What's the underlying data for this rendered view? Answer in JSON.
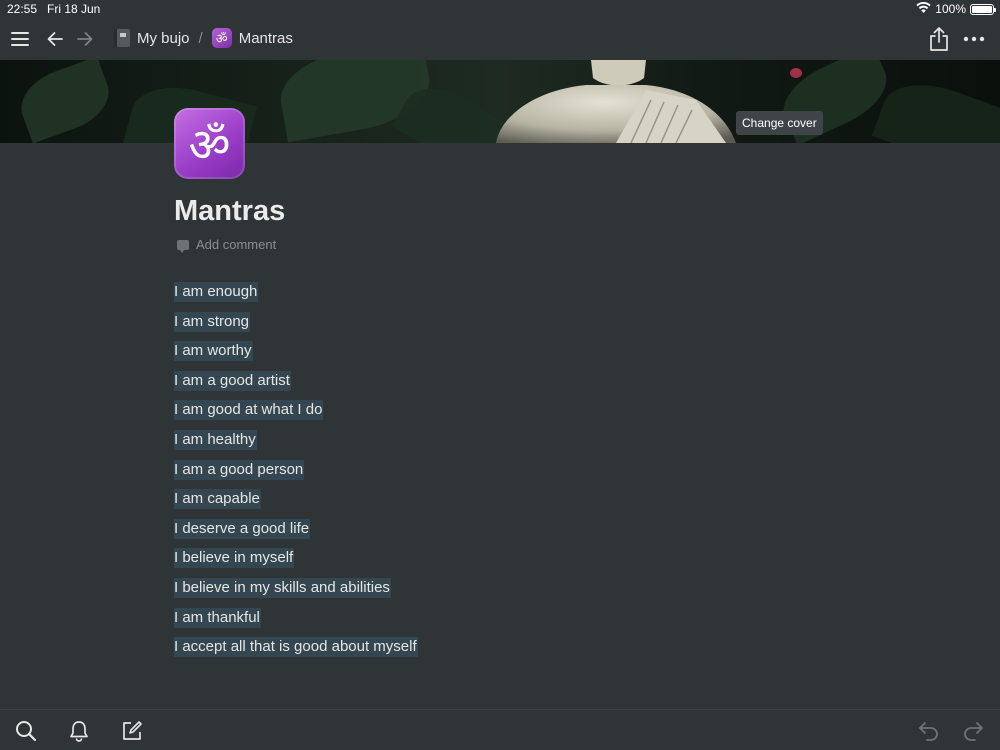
{
  "status_bar": {
    "time": "22:55",
    "date": "Fri 18 Jun",
    "battery": "100%",
    "battery_level": 1.0
  },
  "nav": {
    "menu_icon": "hamburger-icon",
    "back_icon": "arrow-left-icon",
    "forward_icon": "arrow-right-icon",
    "share_icon": "share-icon",
    "more_icon": "more-horizontal-icon"
  },
  "breadcrumb": {
    "parent": {
      "label": "My bujo",
      "icon": "notebook-icon"
    },
    "separator": "/",
    "current": {
      "label": "Mantras",
      "icon": "om-icon"
    }
  },
  "cover": {
    "change_cover_label": "Change cover"
  },
  "page": {
    "icon_glyph": "ॐ",
    "title": "Mantras",
    "add_comment_label": "Add comment",
    "mantras": [
      "I am enough",
      "I am strong",
      "I am worthy",
      "I am a good artist",
      "I am good at what I do",
      "I am healthy",
      "I am a good person",
      "I am capable",
      "I deserve a good life",
      "I believe in myself",
      "I believe in my skills and abilities",
      "I am thankful",
      "I accept all that is good about myself"
    ]
  },
  "bottom_bar": {
    "search_icon": "search-icon",
    "notifications_icon": "bell-icon",
    "new_page_icon": "compose-icon",
    "undo_icon": "undo-icon",
    "redo_icon": "redo-icon"
  },
  "colors": {
    "background": "#2f3437",
    "text": "#e6e6e5",
    "highlight": "#344650",
    "muted": "#8c8e90",
    "page_icon": "#9b3fc9"
  }
}
